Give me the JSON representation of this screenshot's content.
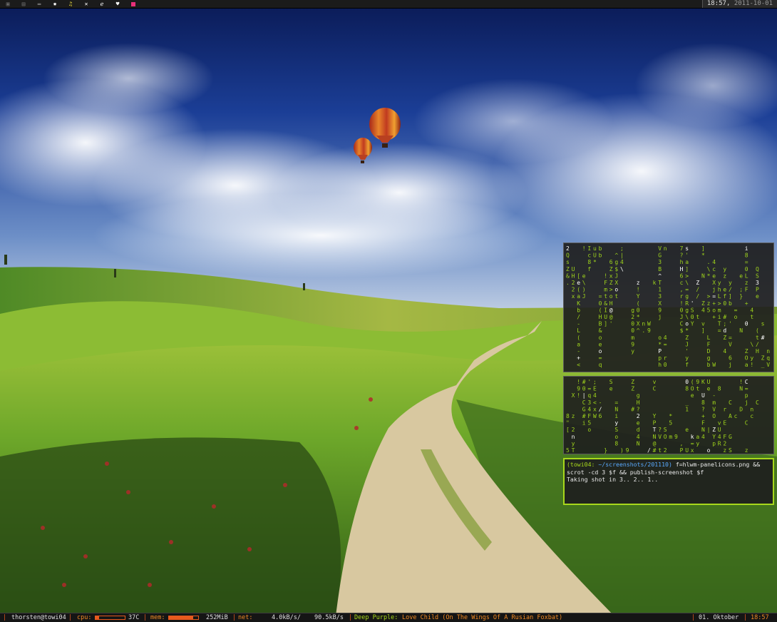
{
  "top_panel": {
    "tags": [
      {
        "icon": "monitor-dim-icon"
      },
      {
        "icon": "terminal-dim-icon"
      },
      {
        "icon": "window-dim-icon"
      },
      {
        "icon": "tools-icon"
      },
      {
        "icon": "music-note-icon"
      },
      {
        "icon": "crossed-tools-icon"
      },
      {
        "icon": "browser-e-icon"
      },
      {
        "icon": "chat-heart-icon"
      },
      {
        "icon": "pink-square-icon"
      }
    ],
    "clock_time": "18:57,",
    "clock_date": "2011-10-01"
  },
  "terminal": {
    "prompt": "(towi04:",
    "path": "~/screenshots/201110)",
    "command_line1": " f=hlwm-panelicons.png &&",
    "command_line2": "scrot -cd 3 $f && publish-screenshot $f",
    "output": "Taking shot in 3.. 2.. 1.."
  },
  "matrix_top": [
    "2  !Iub   ;      Vn  7s  ]       i",
    "Q   cUb  ^|      G   ?'  *       8",
    "s   8*  6g4      3   ha   .4     =",
    "ZU  f   Z$\\      B   H]   \\c y   0 Q",
    "&H[e   !xJ       ^   6>  N*e z  eL S",
    ".2e\\   FZX   z  kT   c\\ Z  Xy y  z 3",
    " 2()   m>o   !   1   ,= /  jhe/ ;F P",
    " xaJ  =tot   Y   3   rg / >=Lf] }  e",
    "  K   0&H    (   X   !R' Zz+>0b  +",
    "  b   (I@   g0   9   0gS 45om  =  4",
    "  /   HU@   2*   j   J\\0t  +i# o  t",
    "  -   B]'   0XnW     CoY v  T;'  0  s",
    "  L   &     0^.9     $*  ]  =d  N  (",
    "  (   o     m    o4   Z   L  Z=    t#",
    "  a   e     9    *=   J   F   V   \\/",
    "  -   o     y    P    '   D  4   Z H n",
    "  +   =          pr   y   g   6  Oy Zq",
    "  <   q          h0   f   bW  j  a! _V"
  ],
  "matrix_bottom": [
    "  !#';  S   Z   v     0(9KU     !C",
    "  90=E  e   Z   C     8Ot e 8   N=",
    " X!|q4       g         e U -     p",
    "   C3<-  =   H        _  8 m  C  j C",
    "   G4x/  N  #?        1  ? V r  D n",
    "8z #FW6  i   2  Y  *     + O  Ac  c",
    "\"  i5    y   e  P  5     F  vE   C",
    "[2  o    S   d  T?S   e  N|ZU",
    " n       o   4  NVOm9  ka4 Y4FG",
    " y       8   N  @    , =y  pR2",
    "5T     }  )9   /#t2  PUx  o  zS  z"
  ],
  "bottom_panel": {
    "user_host": "thorsten@towi04",
    "cpu_label": "cpu:",
    "cpu_level": 0.12,
    "cpu_temp": "37C",
    "mem_label": "mem:",
    "mem_level": 0.82,
    "mem_used": "252MiB",
    "net_label": "net:",
    "net_up": "4.0kB/s/",
    "net_down": "90.5kB/s",
    "track_artist": "Deep Purple:",
    "track_title": "Love Child (On The Wings Of A Rusian Foxbat)",
    "date": "01. Oktober",
    "time": "18:57"
  }
}
